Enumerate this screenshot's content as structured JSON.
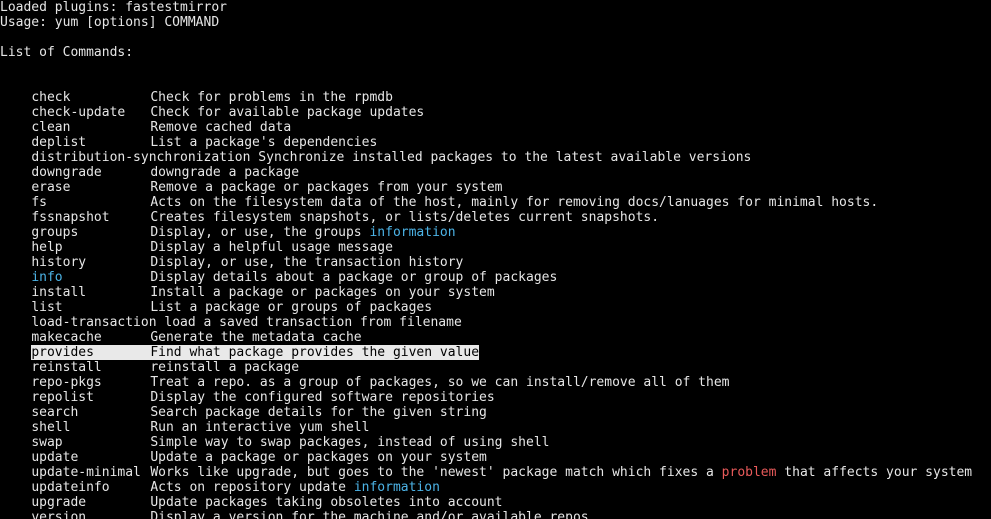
{
  "header": {
    "line1": "Loaded plugins: fastestmirror",
    "line2": "Usage: yum [options] COMMAND",
    "list_title": "List of Commands:"
  },
  "commands": [
    {
      "cmd": "check",
      "desc": "Check for problems in the rpmdb"
    },
    {
      "cmd": "check-update",
      "desc": "Check for available package updates"
    },
    {
      "cmd": "clean",
      "desc": "Remove cached data"
    },
    {
      "cmd": "deplist",
      "desc": "List a package's dependencies"
    },
    {
      "cmd": "distribution-synchronization",
      "desc": " Synchronize installed packages to the latest available versions"
    },
    {
      "cmd": "downgrade",
      "desc": "downgrade a package"
    },
    {
      "cmd": "erase",
      "desc": "Remove a package or packages from your system"
    },
    {
      "cmd": "fs",
      "desc": "Acts on the filesystem data of the host, mainly for removing docs/lanuages for minimal hosts."
    },
    {
      "cmd": "fssnapshot",
      "desc": "Creates filesystem snapshots, or lists/deletes current snapshots."
    },
    {
      "cmd": "groups",
      "desc_a": "Display, or use, the groups ",
      "desc_b": "information"
    },
    {
      "cmd": "help",
      "desc": "Display a helpful usage message"
    },
    {
      "cmd": "history",
      "desc": "Display, or use, the transaction history"
    },
    {
      "cmd": "info",
      "desc": "Display details about a package or group of packages"
    },
    {
      "cmd": "install",
      "desc": "Install a package or packages on your system"
    },
    {
      "cmd": "list",
      "desc": "List a package or groups of packages"
    },
    {
      "cmd": "load-transaction",
      "desc": " load a saved transaction from filename"
    },
    {
      "cmd": "makecache",
      "desc": "Generate the metadata cache"
    },
    {
      "cmd": "provides",
      "desc": "Find what package provides the given value"
    },
    {
      "cmd": "reinstall",
      "desc": "reinstall a package"
    },
    {
      "cmd": "repo-pkgs",
      "desc": "Treat a repo. as a group of packages, so we can install/remove all of them"
    },
    {
      "cmd": "repolist",
      "desc": "Display the configured software repositories"
    },
    {
      "cmd": "search",
      "desc": "Search package details for the given string"
    },
    {
      "cmd": "shell",
      "desc": "Run an interactive yum shell"
    },
    {
      "cmd": "swap",
      "desc": "Simple way to swap packages, instead of using shell"
    },
    {
      "cmd": "update",
      "desc": "Update a package or packages on your system"
    },
    {
      "cmd": "update-minimal",
      "desc_a": "Works like upgrade, but goes to the 'newest' package match which fixes a ",
      "desc_b": "problem",
      "desc_c": " that affects your system"
    },
    {
      "cmd": "updateinfo",
      "desc_a": "Acts on repository update ",
      "desc_b": "information"
    },
    {
      "cmd": "upgrade",
      "desc": "Update packages taking obsoletes into account"
    },
    {
      "cmd": "version",
      "desc": "Display a version for the machine and/or available repos."
    }
  ],
  "colors": {
    "background": "#000000",
    "foreground": "#e6e6e6",
    "highlight_blue": "#4cb3e6",
    "highlight_red": "#e85a5a",
    "selection_bg": "#e9e9e9"
  }
}
